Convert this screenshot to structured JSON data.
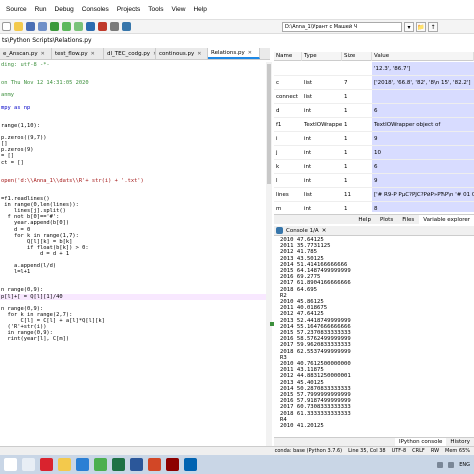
{
  "menu": [
    "Source",
    "Run",
    "Debug",
    "Consoles",
    "Projects",
    "Tools",
    "View",
    "Help"
  ],
  "path_field": "D:\\Anna_1\\Урант с Машей Ч",
  "editor": {
    "file_path": "ts\\Python Scripts\\Relations.py",
    "tabs": [
      {
        "label": "e_Anscan.py",
        "active": false
      },
      {
        "label": "test_flow.py",
        "active": false
      },
      {
        "label": "dl_TEC_codg.py",
        "active": false
      },
      {
        "label": "continous.py",
        "active": false
      },
      {
        "label": "Relations.py",
        "active": true
      }
    ],
    "lines": [
      {
        "t": "ding: utf-8 -*-",
        "c": "com"
      },
      {
        "t": "",
        "c": ""
      },
      {
        "t": "",
        "c": ""
      },
      {
        "t": "on Thu Nov 12 14:31:05 2020",
        "c": "com"
      },
      {
        "t": "",
        "c": ""
      },
      {
        "t": "anmy",
        "c": "com"
      },
      {
        "t": "",
        "c": ""
      },
      {
        "t": "mpy as np",
        "c": "kw"
      },
      {
        "t": "",
        "c": ""
      },
      {
        "t": "",
        "c": ""
      },
      {
        "t": "range(1,10):",
        "c": ""
      },
      {
        "t": "",
        "c": ""
      },
      {
        "t": "p.zeros((9,7))",
        "c": ""
      },
      {
        "t": "[]",
        "c": ""
      },
      {
        "t": "p.zeros(9)",
        "c": ""
      },
      {
        "t": "= []",
        "c": ""
      },
      {
        "t": "ct = []",
        "c": ""
      },
      {
        "t": "",
        "c": ""
      },
      {
        "t": "",
        "c": ""
      },
      {
        "t": "open('d:\\\\Anna_1\\\\dats\\\\R'+ str(i) + '.txt')",
        "c": "str"
      },
      {
        "t": "",
        "c": ""
      },
      {
        "t": "",
        "c": ""
      },
      {
        "t": "=f1.readlines()",
        "c": ""
      },
      {
        "t": " in range(0,len(lines)):",
        "c": ""
      },
      {
        "t": "    lines[j].split()",
        "c": ""
      },
      {
        "t": "  f not b[0]=='#':",
        "c": ""
      },
      {
        "t": "    year.append(b[0])",
        "c": ""
      },
      {
        "t": "    d = 0",
        "c": ""
      },
      {
        "t": "    for k in range(1,7):",
        "c": ""
      },
      {
        "t": "        Q[l][k] = b[k]",
        "c": ""
      },
      {
        "t": "        if float(b[k]) > 0:",
        "c": ""
      },
      {
        "t": "            d = d + 1",
        "c": ""
      },
      {
        "t": "",
        "c": ""
      },
      {
        "t": "    a.append(l/d)",
        "c": ""
      },
      {
        "t": "    l=l+1",
        "c": ""
      },
      {
        "t": "",
        "c": ""
      },
      {
        "t": "",
        "c": ""
      },
      {
        "t": "n range(0,9):",
        "c": ""
      },
      {
        "t": "p[l]+[ = Q[l][1]/40",
        "c": "hl"
      },
      {
        "t": "",
        "c": ""
      },
      {
        "t": "n range(0,9):",
        "c": ""
      },
      {
        "t": "  for k in range(2,7):",
        "c": ""
      },
      {
        "t": "      C[l] = C[l] + a[l]*Q[l][k]",
        "c": ""
      },
      {
        "t": "  ('R'+str(i))",
        "c": ""
      },
      {
        "t": "  in range(0,9):",
        "c": ""
      },
      {
        "t": "  rint(year[l], C[m])",
        "c": ""
      }
    ]
  },
  "variables": {
    "headers": [
      "Name",
      "Type",
      "Size",
      "Value"
    ],
    "rows": [
      {
        "name": "",
        "type": "",
        "size": "",
        "value": "'12.3', '86.7']"
      },
      {
        "name": "c",
        "type": "list",
        "size": "7",
        "value": "['2018', '66.8', '82', '8\\n 15', '82.2']"
      },
      {
        "name": "connect",
        "type": "list",
        "size": "1",
        "value": ""
      },
      {
        "name": "d",
        "type": "int",
        "size": "1",
        "value": "6"
      },
      {
        "name": "f1",
        "type": "TextIOWrapper",
        "size": "1",
        "value": "TextIOWrapper object of"
      },
      {
        "name": "i",
        "type": "int",
        "size": "1",
        "value": "9"
      },
      {
        "name": "j",
        "type": "int",
        "size": "1",
        "value": "10"
      },
      {
        "name": "k",
        "type": "int",
        "size": "1",
        "value": "6"
      },
      {
        "name": "l",
        "type": "int",
        "size": "1",
        "value": "9"
      },
      {
        "name": "lines",
        "type": "list",
        "size": "11",
        "value": "['# R9-P PμC?PЈC?PйP»PЋР\\n  '#   01   06  07"
      },
      {
        "name": "m",
        "type": "int",
        "size": "1",
        "value": "8"
      },
      {
        "name": "year",
        "type": "list",
        "size": "9",
        "value": "['2010', '2011', '2012',"
      }
    ]
  },
  "var_tabs": [
    "Help",
    "Plots",
    "Files",
    "Variable explorer"
  ],
  "console_tab": "Console 1/A",
  "console_lines": [
    "2010 47.64125",
    "2011 35.7731125",
    "2012 41.785",
    "2013 43.50125",
    "2014 51.414166666666",
    "2015 64.1487499999999",
    "2016 69.2775",
    "2017 61.8904166666666",
    "2018 64.695",
    "R2",
    "2010 45.86125",
    "2011 40.018675",
    "2012 47.64125",
    "2013 52.4418749999999",
    "2014 55.1647666666666",
    "2015 57.2370833333333",
    "2016 58.5762499999999",
    "2017 59.9620833333333",
    "2018 62.5537499999999",
    "R3",
    "2010 40.7612500000000",
    "2011 43.11875",
    "2012 44.8831250000001",
    "2013 45.40125",
    "2014 50.2870833333333",
    "2015 57.7999999999999",
    "2016 57.9187499999999",
    "2017 60.7308333333333",
    "2018 61.3333333333333",
    "R4",
    "2010 41.20125"
  ],
  "console_tabs": [
    "IPython console",
    "History"
  ],
  "status": {
    "conda": "conda: base (Python 3.7.6)",
    "pos": "Line 35, Col 38",
    "enc": "UTF-8",
    "eol": "CRLF",
    "rw": "RW",
    "mem": "Mem 65%"
  },
  "taskbar_icons": [
    {
      "name": "windows-start-icon",
      "color": "#ffffff"
    },
    {
      "name": "search-icon",
      "color": "#e8eef5"
    },
    {
      "name": "opera-icon",
      "color": "#d9232e"
    },
    {
      "name": "folder-icon",
      "color": "#f3c94c"
    },
    {
      "name": "edge-icon",
      "color": "#2a7fd4"
    },
    {
      "name": "chrome-icon",
      "color": "#4caf50"
    },
    {
      "name": "excel-icon",
      "color": "#1e7145"
    },
    {
      "name": "word-icon",
      "color": "#2b579a"
    },
    {
      "name": "powerpoint-icon",
      "color": "#d24726"
    },
    {
      "name": "spyder-icon",
      "color": "#8c0000"
    },
    {
      "name": "photos-icon",
      "color": "#0063b1"
    }
  ],
  "tray_clock": "ENG"
}
